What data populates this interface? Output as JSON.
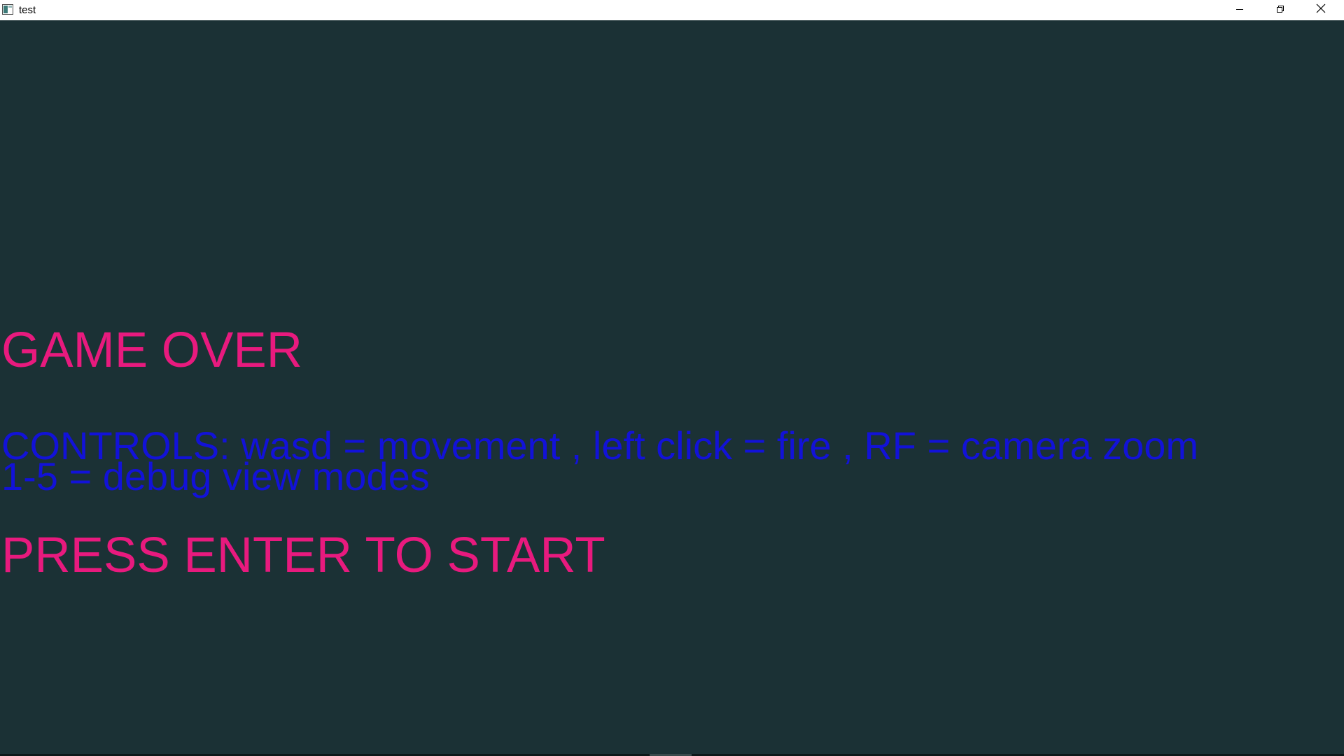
{
  "window": {
    "title": "test",
    "icons": {
      "app": "app-window-icon",
      "minimize": "minimize-icon",
      "maximize": "restore-icon",
      "close": "close-icon"
    }
  },
  "game": {
    "game_over_text": "GAME OVER",
    "controls_line1": "CONTROLS: wasd = movement , left click = fire , RF = camera zoom",
    "controls_line2": "1-5 = debug view modes",
    "press_start_text": "PRESS ENTER TO START"
  },
  "colors": {
    "background": "#1b3135",
    "title_text": "#e81a7e",
    "controls_text": "#1212d8",
    "titlebar": "#ffffff"
  }
}
